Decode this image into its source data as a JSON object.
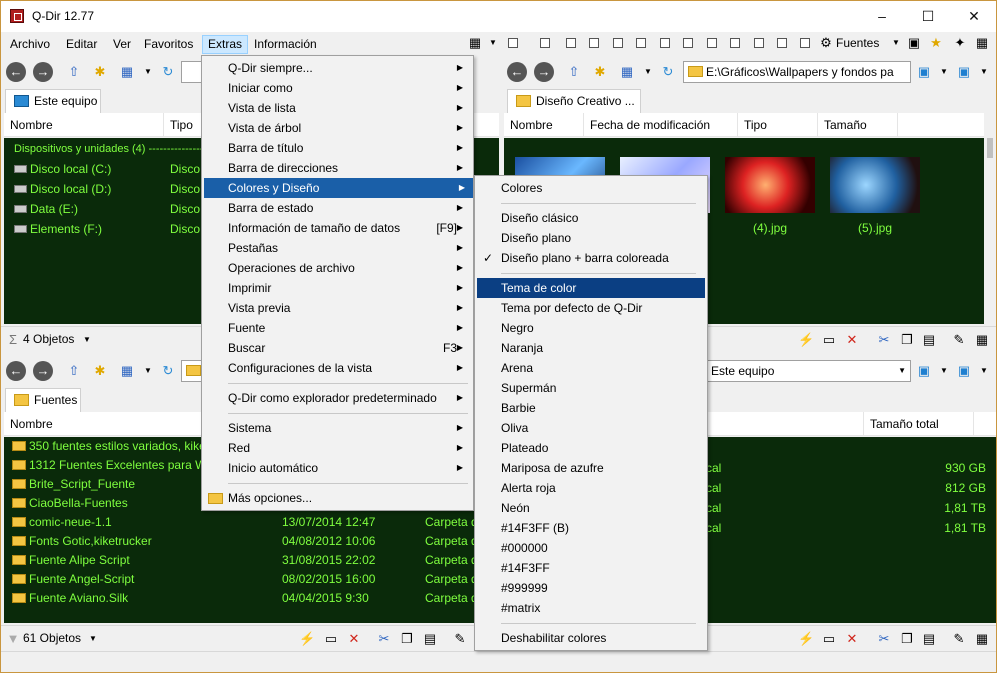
{
  "title": "Q-Dir 12.77",
  "menubar": [
    "Archivo",
    "Editar",
    "Ver",
    "Favoritos",
    "Extras",
    "Información"
  ],
  "toolbar_right": {
    "fonts_label": "Fuentes"
  },
  "pane_tl": {
    "tab": "Este equipo",
    "columns": [
      "Nombre",
      "Tipo"
    ],
    "group": "Dispositivos y unidades (4) ---------------------------------",
    "rows": [
      {
        "name": "Disco local (C:)",
        "type": "Disco l"
      },
      {
        "name": "Disco local (D:)",
        "type": "Disco l"
      },
      {
        "name": "Data (E:)",
        "type": "Disco l"
      },
      {
        "name": "Elements (F:)",
        "type": "Disco l"
      }
    ],
    "status": "4 Objetos"
  },
  "pane_tr": {
    "path": "E:\\Gráficos\\Wallpapers y fondos pa",
    "tab": "Diseño Creativo  ...",
    "columns": [
      "Nombre",
      "Fecha de modificación",
      "Tipo",
      "Tamaño"
    ],
    "thumb_labels": [
      "(4).jpg",
      "(5).jpg"
    ]
  },
  "pane_bl": {
    "tab": "Fuentes",
    "columns": [
      "Nombre"
    ],
    "rows": [
      {
        "name": "350 fuentes estilos variados, kiketruc",
        "date": "",
        "type": ""
      },
      {
        "name": "1312 Fuentes Excelentes para Wind",
        "date": "",
        "type": ""
      },
      {
        "name": "Brite_Script_Fuente",
        "date": "",
        "type": ""
      },
      {
        "name": "CiaoBella-Fuentes",
        "date": "",
        "type": ""
      },
      {
        "name": "comic-neue-1.1",
        "date": "13/07/2014 12:47",
        "type": "Carpeta de"
      },
      {
        "name": "Fonts Gotic,kiketrucker",
        "date": "04/08/2012 10:06",
        "type": "Carpeta de"
      },
      {
        "name": "Fuente Alipe Script",
        "date": "31/08/2015 22:02",
        "type": "Carpeta de"
      },
      {
        "name": "Fuente Angel-Script",
        "date": "08/02/2015 16:00",
        "type": "Carpeta de"
      },
      {
        "name": "Fuente Aviano.Silk",
        "date": "04/04/2015 9:30",
        "type": "Carpeta de"
      }
    ],
    "status": "61 Objetos"
  },
  "pane_br": {
    "path": "Este equipo",
    "columns": [
      "Tamaño total"
    ],
    "rows": [
      {
        "type": "cal",
        "size": "930 GB"
      },
      {
        "type": "cal",
        "size": "812 GB"
      },
      {
        "type": "cal",
        "size": "1,81 TB"
      },
      {
        "type": "cal",
        "size": "1,81 TB"
      }
    ]
  },
  "extras_menu": [
    {
      "label": "Q-Dir siempre...",
      "arrow": true
    },
    {
      "label": "Iniciar como",
      "arrow": true
    },
    {
      "label": "Vista de lista",
      "arrow": true
    },
    {
      "label": "Vista de árbol",
      "arrow": true
    },
    {
      "label": "Barra de título",
      "arrow": true
    },
    {
      "label": "Barra de direcciones",
      "arrow": true
    },
    {
      "label": "Colores y Diseño",
      "arrow": true
    },
    {
      "label": "Barra de estado",
      "arrow": true
    },
    {
      "label": "Información de tamaño de datos",
      "shortcut": "[F9]",
      "arrow": true
    },
    {
      "label": "Pestañas",
      "arrow": true
    },
    {
      "label": "Operaciones de archivo",
      "arrow": true
    },
    {
      "label": "Imprimir",
      "arrow": true
    },
    {
      "label": "Vista previa",
      "arrow": true
    },
    {
      "label": "Fuente",
      "arrow": true
    },
    {
      "label": "Buscar",
      "shortcut": "F3",
      "arrow": true
    },
    {
      "label": "Configuraciones de la vista",
      "arrow": true
    },
    {
      "label": "Q-Dir como explorador predeterminado",
      "arrow": true
    },
    {
      "label": "Sistema",
      "arrow": true
    },
    {
      "label": "Red",
      "arrow": true
    },
    {
      "label": "Inicio automático",
      "arrow": true
    },
    {
      "label": "Más opciones..."
    }
  ],
  "colors_menu": [
    "Colores",
    "Diseño clásico",
    "Diseño plano",
    "Diseño plano + barra coloreada",
    "Tema de color",
    "Tema por defecto de Q-Dir",
    "Negro",
    "Naranja",
    "Arena",
    "Supermán",
    "Barbie",
    "Oliva",
    "Plateado",
    "Mariposa de azufre",
    "Alerta roja",
    "Neón",
    "#14F3FF (B)",
    "#000000",
    "#14F3FF",
    "#999999",
    "#matrix",
    "Deshabilitar colores"
  ],
  "colors": {
    "list_bg": "#0a2a0a",
    "list_text": "#7fff3f",
    "menu_highlight": "#1a5fa8",
    "menu_highlight_dark": "#0b3f83"
  }
}
